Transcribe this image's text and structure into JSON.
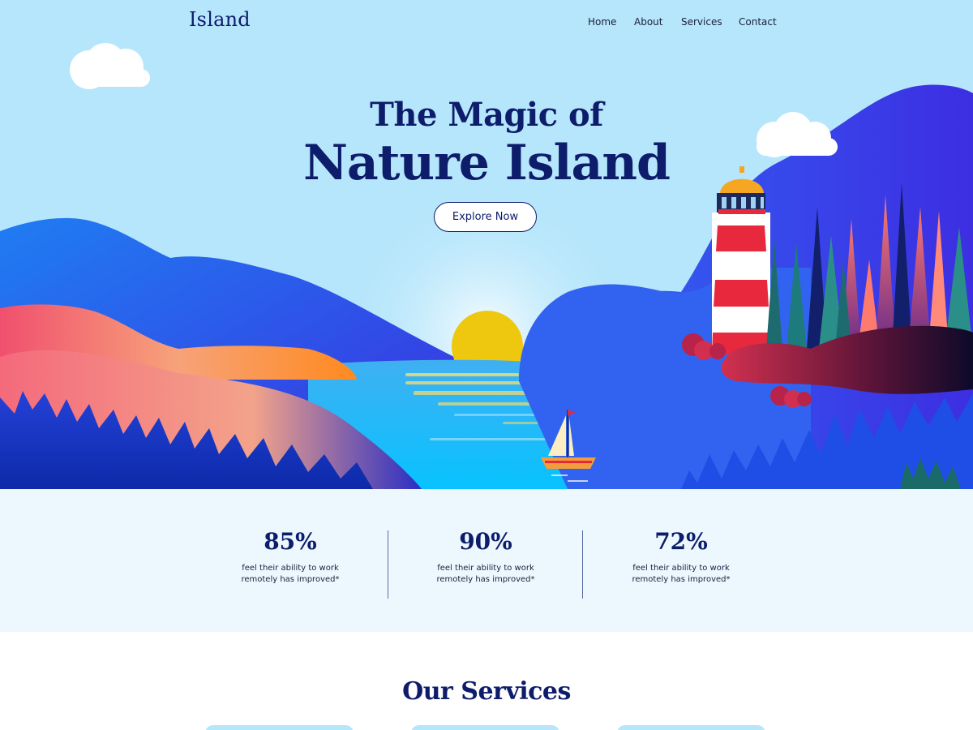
{
  "brand": {
    "logo_text": "Island"
  },
  "nav": {
    "items": [
      "Home",
      "About",
      "Services",
      "Contact"
    ]
  },
  "hero": {
    "title_line1": "The Magic of",
    "title_line2": "Nature Island",
    "cta_label": "Explore Now"
  },
  "stats": [
    {
      "value": "85%",
      "desc_line1": "feel their ability to work",
      "desc_line2": "remotely has improved*"
    },
    {
      "value": "90%",
      "desc_line1": "feel their ability to work",
      "desc_line2": "remotely has improved*"
    },
    {
      "value": "72%",
      "desc_line1": "feel their ability to work",
      "desc_line2": "remotely has improved*"
    }
  ],
  "services": {
    "title": "Our Services"
  },
  "colors": {
    "sky": "#b6e6fb",
    "navy": "#0d1c6b",
    "sun": "#f1c40f",
    "water": "#2bb4f0",
    "stats_bg": "#edf8fe"
  }
}
